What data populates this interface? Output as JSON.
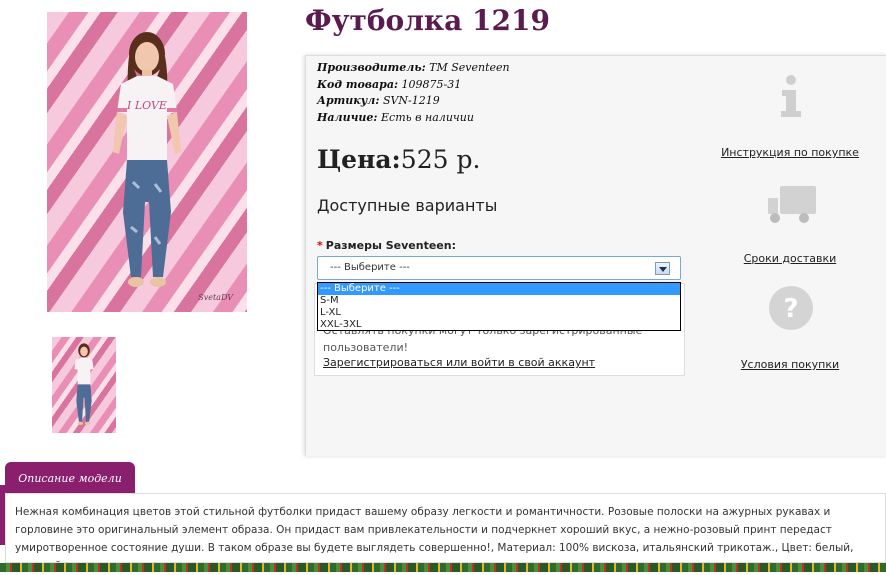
{
  "product": {
    "title": "Футболка 1219",
    "manufacturer_label": "Производитель:",
    "manufacturer_value": "TM Seventeen",
    "code_label": "Код товара:",
    "code_value": "109875-31",
    "article_label": "Артикул:",
    "article_value": "SVN-1219",
    "availability_label": "Наличие:",
    "availability_value": "Есть в наличии",
    "price_label": "Цена:",
    "price_value": "525 р.",
    "variants_heading": "Доступные варианты",
    "size_required_mark": "*",
    "size_label": "Размеры Seventeen:",
    "size_select_value": "--- Выберите ---",
    "size_options": [
      "--- Выберите ---",
      "S-M",
      "L-XL",
      "XXL-3XL"
    ],
    "login_text_line1": "Оставлять покупки могут только зарегистрированные",
    "login_text_line2": "пользователи!",
    "login_link": "Зарегистрироваться или войти в свой аккаунт"
  },
  "side_links": {
    "instruction": "Инструкция по покупке",
    "delivery": "Сроки доставки",
    "conditions": "Условия покупки"
  },
  "description": {
    "tab_label": "Описание модели",
    "text": "Нежная комбинация цветов этой стильной футболки придаст вашему образу легкости и романтичности. Розовые полоски на ажурных рукавах и горловине это оригинальный элемент образа. Он придаст вам привлекательности и подчеркнет хороший вкус, а нежно-розовый принт передаст умиротворенное состояние души. В таком образе вы будете выглядеть совершенно!, Материал: 100% вискоза, итальянский трикотаж., Цвет: белый, розовый."
  },
  "image_caption": "SvetaDV",
  "print_text": "I LOVE"
}
